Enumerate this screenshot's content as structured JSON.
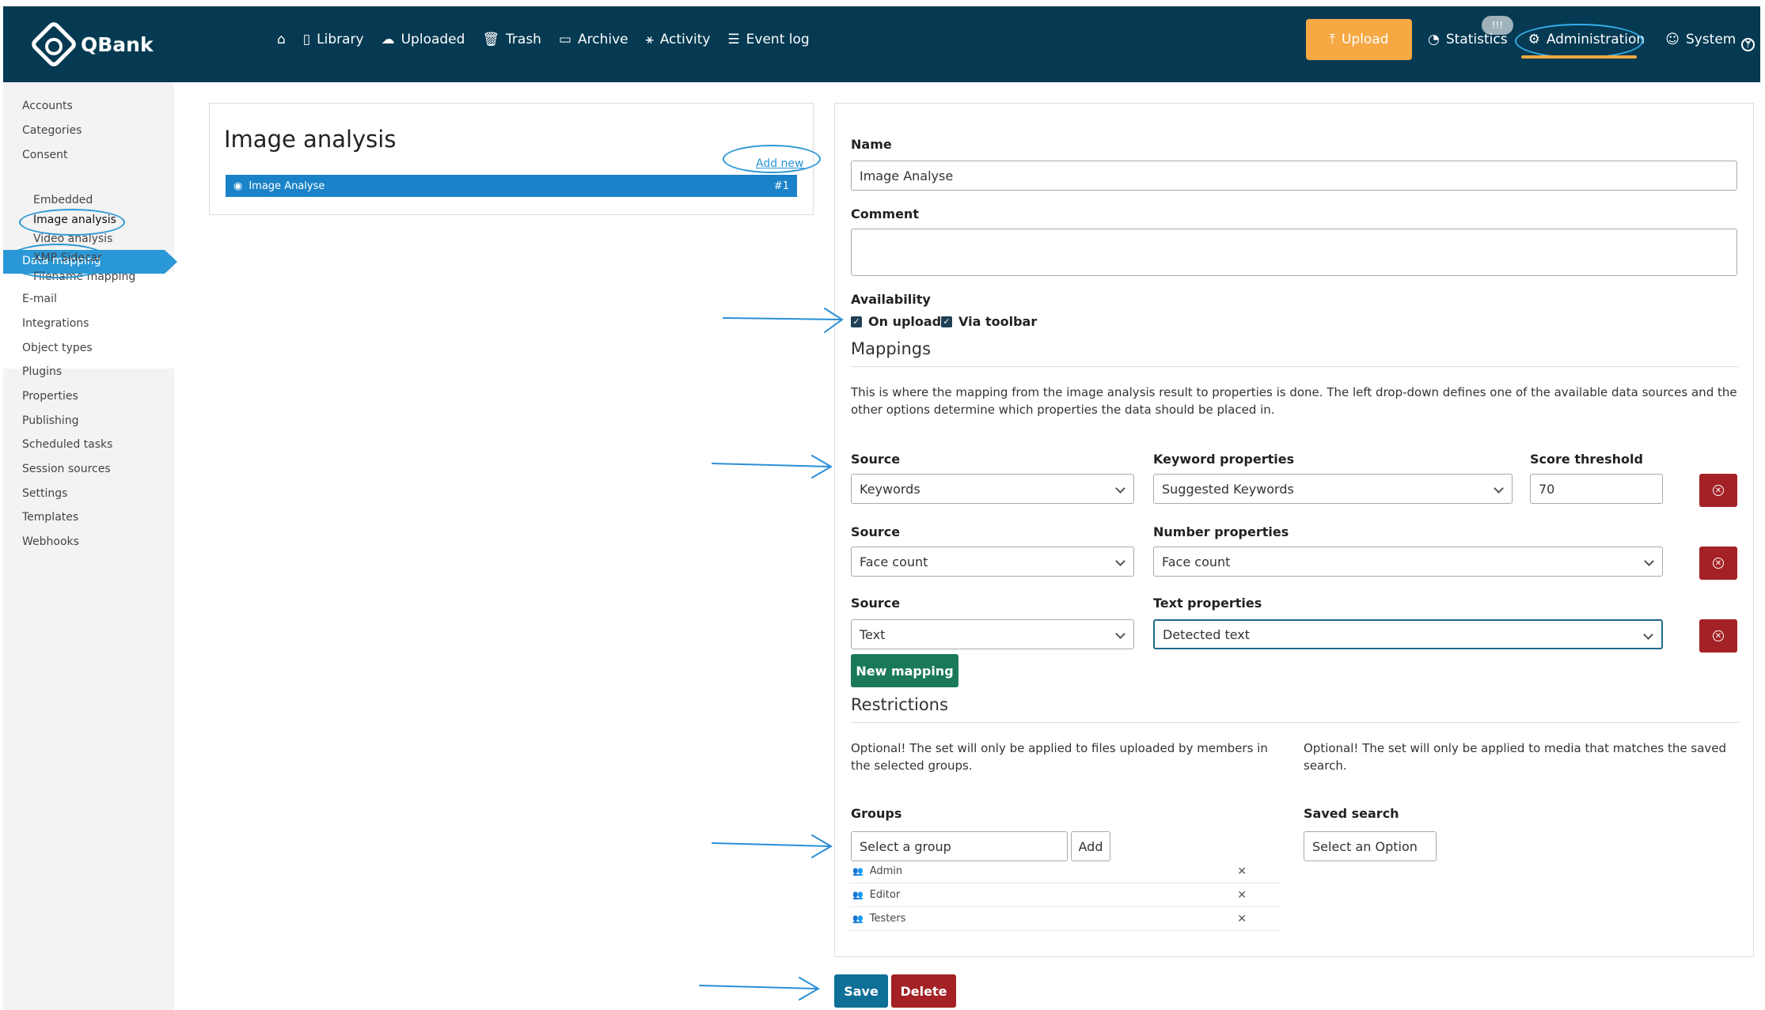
{
  "header": {
    "logo": "QBank",
    "nav": [
      {
        "label": "",
        "icon": "home-icon"
      },
      {
        "label": "Library",
        "icon": "book-icon"
      },
      {
        "label": "Uploaded",
        "icon": "cloud-icon"
      },
      {
        "label": "Trash",
        "icon": "trash-icon"
      },
      {
        "label": "Archive",
        "icon": "archive-icon"
      },
      {
        "label": "Activity",
        "icon": "activity-icon"
      },
      {
        "label": "Event log",
        "icon": "list-icon"
      }
    ],
    "upload_label": "Upload",
    "stats_badge": "!!!",
    "statistics_label": "Statistics",
    "administration_label": "Administration",
    "system_label": "System"
  },
  "sidebar": {
    "items": [
      "Accounts",
      "Categories",
      "Consent",
      "Data mapping",
      "Embedded",
      "Image analysis",
      "Video analysis",
      "XMP Sidecar",
      "Filename mapping",
      "E-mail",
      "Integrations",
      "Object types",
      "Plugins",
      "Properties",
      "Publishing",
      "Scheduled tasks",
      "Session sources",
      "Settings",
      "Templates",
      "Webhooks"
    ]
  },
  "list": {
    "title": "Image analysis",
    "add_new": "Add new",
    "row_label": "Image Analyse",
    "row_id": "#1"
  },
  "form": {
    "name_label": "Name",
    "name_value": "Image Analyse",
    "comment_label": "Comment",
    "availability_label": "Availability",
    "on_upload": "On upload",
    "via_toolbar": "Via toolbar",
    "mappings_title": "Mappings",
    "mappings_desc": "This is where the mapping from the image analysis result to properties is done. The left drop-down defines one of the available data sources and the other options determine which properties the data should be placed in.",
    "mappings": [
      {
        "source_label": "Source",
        "source_value": "Keywords",
        "prop_label": "Keyword properties",
        "prop_value": "Suggested Keywords",
        "threshold_label": "Score threshold",
        "threshold_value": "70"
      },
      {
        "source_label": "Source",
        "source_value": "Face count",
        "prop_label": "Number properties",
        "prop_value": "Face count"
      },
      {
        "source_label": "Source",
        "source_value": "Text",
        "prop_label": "Text properties",
        "prop_value": "Detected text"
      }
    ],
    "new_mapping": "New mapping",
    "restrictions_title": "Restrictions",
    "restrict_groups_desc": "Optional! The set will only be applied to files uploaded by members in the selected groups.",
    "restrict_search_desc": "Optional! The set will only be applied to media that matches the saved search.",
    "groups_label": "Groups",
    "group_placeholder": "Select a group",
    "add_label": "Add",
    "groups": [
      "Admin",
      "Editor",
      "Testers"
    ],
    "saved_search_label": "Saved search",
    "saved_search_placeholder": "Select an Option"
  },
  "actions": {
    "save": "Save",
    "delete": "Delete"
  },
  "colors": {
    "topbar": "#053a52",
    "upload": "#f6a843",
    "active": "#2a97d6",
    "green": "#1a7a58",
    "danger": "#a42125"
  }
}
